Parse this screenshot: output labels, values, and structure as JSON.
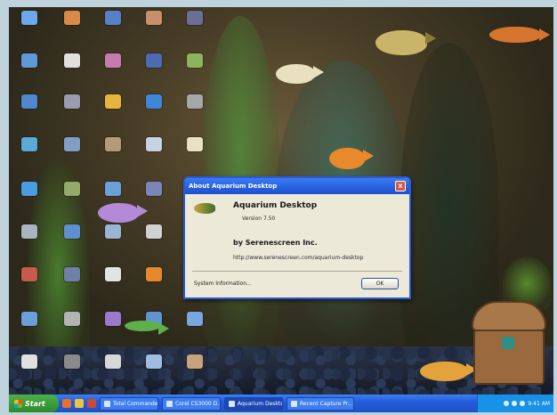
{
  "dialog": {
    "title": "About Aquarium Desktop",
    "product_name": "Aquarium Desktop",
    "version": "Version 7.50",
    "company": "by Serenescreen Inc.",
    "url": "http://www.serenescreen.com/aquarium-desktop",
    "system_info": "System Information...",
    "ok_label": "OK",
    "close_glyph": "x"
  },
  "taskbar": {
    "start_label": "Start",
    "tasks": [
      "Total Commander 6...",
      "Corel CS3000 D...",
      "Aquarium Desktop",
      "Recent Capture Pr..."
    ],
    "clock": "9:41 AM"
  },
  "colors": {
    "taskbar_blue": "#245ddb",
    "start_green": "#2d8a2d",
    "dialog_titlebar": "#1c4fcf",
    "dialog_body": "#ece9d8"
  }
}
